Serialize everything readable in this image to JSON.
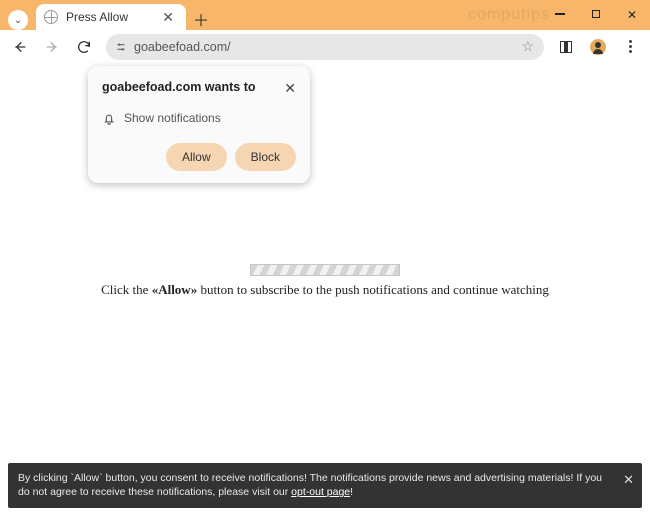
{
  "window": {
    "tab_title": "Press Allow",
    "watermark": "computips"
  },
  "address_bar": {
    "url": "goabeefoad.com/"
  },
  "permission_dialog": {
    "title": "goabeefoad.com wants to",
    "notification_label": "Show notifications",
    "allow_label": "Allow",
    "block_label": "Block"
  },
  "page": {
    "message_prefix": "Click the ",
    "message_strong": "«Allow»",
    "message_suffix": " button to subscribe to the push notifications and continue watching"
  },
  "consent_bar": {
    "text_before": "By clicking `Allow` button, you consent to receive notifications! The notifications provide news and advertising materials! If you do not agree to receive these notifications, please visit our ",
    "link_label": "opt-out page",
    "text_after": "!"
  }
}
